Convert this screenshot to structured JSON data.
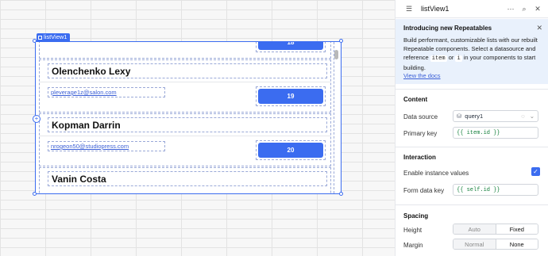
{
  "canvas": {
    "component_tag": "listView1",
    "rows": [
      {
        "name": "",
        "email": "",
        "button": "18"
      },
      {
        "name": "Olenchenko Lexy",
        "email": "pleverage1z@salon.com",
        "button": "19"
      },
      {
        "name": "Kopman Darrin",
        "email": "nrogeon50@studiopress.com",
        "button": "20"
      },
      {
        "name": "Vanin Costa",
        "email": "",
        "button": ""
      }
    ]
  },
  "inspector": {
    "title": "listView1",
    "banner": {
      "title": "Introducing new Repeatables",
      "text_1": "Build performant, customizable lists with our rebuilt Repeatable components. Select a datasource and reference",
      "code_item": "item",
      "or": "or",
      "code_i": "i",
      "text_2": "in your components to start building.",
      "link": "View the docs"
    },
    "content": {
      "title": "Content",
      "data_source_label": "Data source",
      "data_source_value": "query1",
      "primary_key_label": "Primary key",
      "primary_key_value": "{{ item.id }}"
    },
    "interaction": {
      "title": "Interaction",
      "instance_values_label": "Enable instance values",
      "form_data_key_label": "Form data key",
      "form_data_key_value": "{{ self.id }}"
    },
    "spacing": {
      "title": "Spacing",
      "height_label": "Height",
      "height_options": [
        "Auto",
        "Fixed"
      ],
      "margin_label": "Margin",
      "margin_options": [
        "Normal",
        "None"
      ]
    }
  }
}
